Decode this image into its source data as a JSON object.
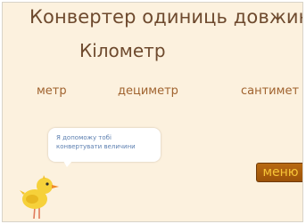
{
  "app": {
    "title": "Конвертер одиниць довжини"
  },
  "current_unit": "Кілометр",
  "unit_options": [
    {
      "label": "метр"
    },
    {
      "label": "дециметр"
    },
    {
      "label": "сантимет"
    }
  ],
  "assistant": {
    "line1": "Я допоможу тобі",
    "line2": "конвертувати величини",
    "icon": "chick-icon"
  },
  "menu_label": "меню",
  "colors": {
    "background": "#fcf1de",
    "title_text": "#6e4a2e",
    "option_text": "#a0632f",
    "bubble_text": "#5c7fb0",
    "menu_bg": "#a95e0c",
    "menu_text": "#f7c437"
  }
}
